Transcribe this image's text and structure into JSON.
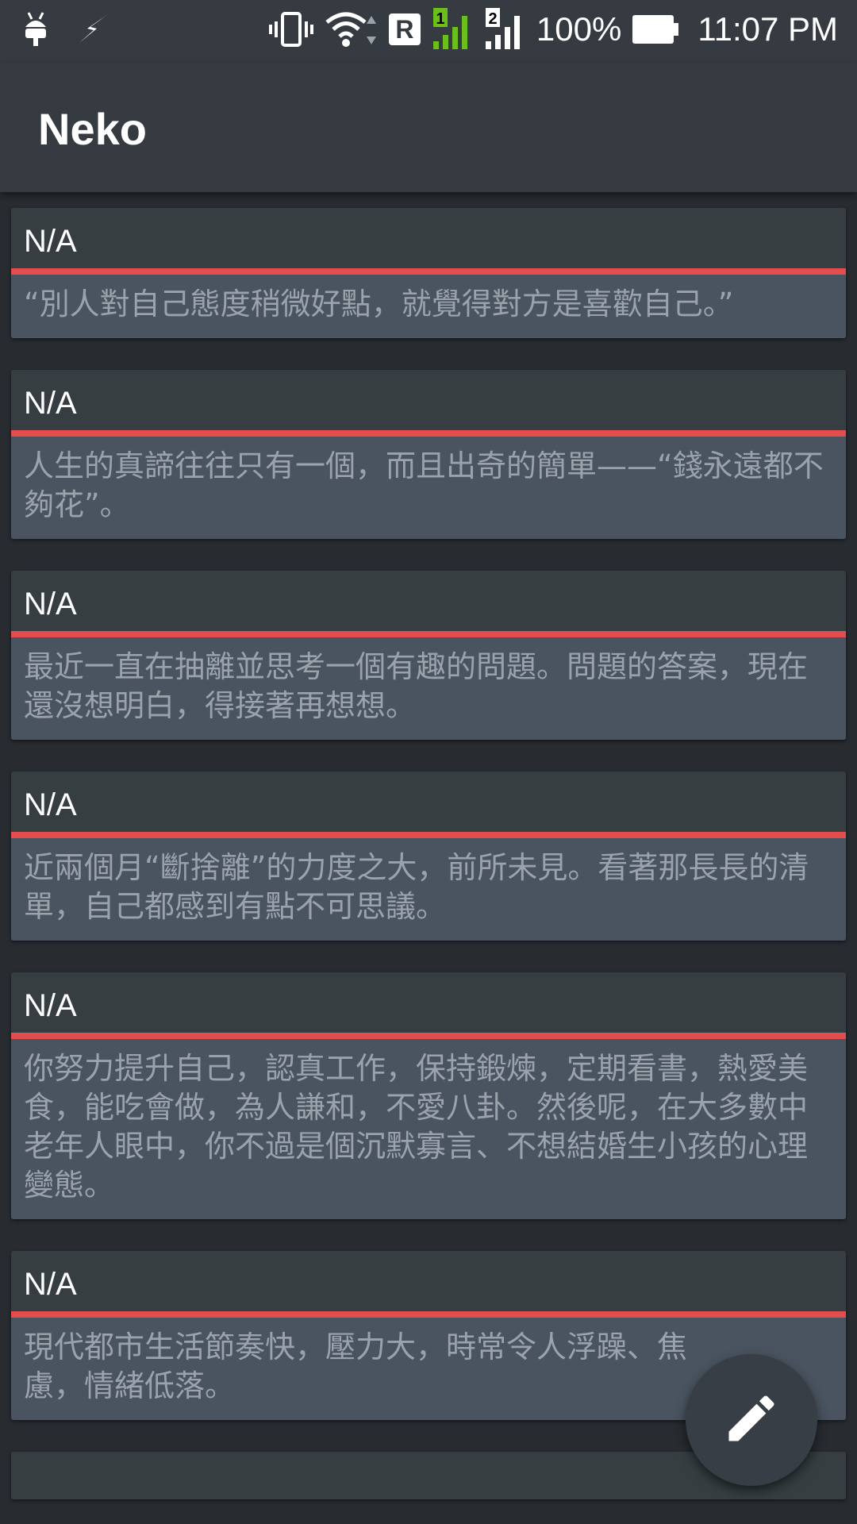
{
  "status_bar": {
    "battery_percent": "100%",
    "time": "11:07 PM",
    "roaming_label": "R",
    "sim1_label": "1",
    "sim2_label": "2",
    "icons": [
      "android-icon",
      "flash-icon",
      "vibrate-icon",
      "wifi-icon",
      "signal-sim1-icon",
      "signal-sim2-icon",
      "battery-icon"
    ]
  },
  "app_bar": {
    "title": "Neko"
  },
  "cards": [
    {
      "title": "N/A",
      "text": "“別人對自己態度稍微好點，就覺得對方是喜歡自己。”"
    },
    {
      "title": "N/A",
      "text": "人生的真諦往往只有一個，而且出奇的簡單——“錢永遠都不夠花”。"
    },
    {
      "title": "N/A",
      "text": "最近一直在抽離並思考一個有趣的問題。問題的答案，現在還沒想明白，得接著再想想。"
    },
    {
      "title": "N/A",
      "text": "近兩個月“斷捨離”的力度之大，前所未見。看著那長長的清單，自己都感到有點不可思議。"
    },
    {
      "title": "N/A",
      "text": "你努力提升自己，認真工作，保持鍛煉，定期看書，熱愛美食，能吃會做，為人謙和，不愛八卦。然後呢，在大多數中老年人眼中，你不過是個沉默寡言、不想結婚生小孩的心理變態。"
    },
    {
      "title": "N/A",
      "text": "現代都市生活節奏快，壓力大，時常令人浮躁、焦慮，情緒低落。"
    }
  ],
  "fab": {
    "icon": "edit-pencil-icon"
  },
  "colors": {
    "accent_bar": "#e34d4d",
    "app_bar": "#353b41",
    "card_body": "#4a5460",
    "background": "#282c31"
  }
}
